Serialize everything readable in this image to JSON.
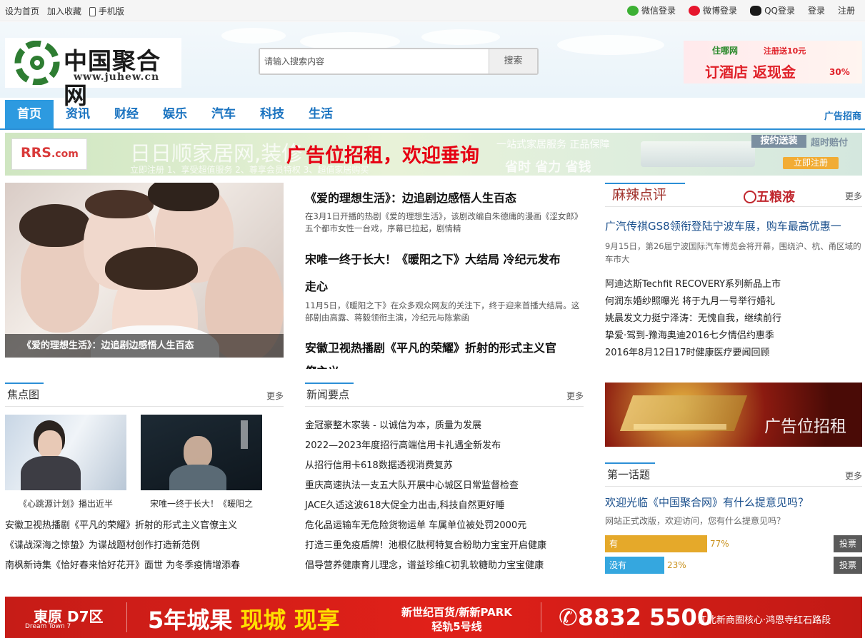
{
  "topbar": {
    "left": [
      "设为首页",
      "加入收藏",
      "手机版"
    ],
    "right": [
      "微信登录",
      "微博登录",
      "QQ登录",
      "登录",
      "注册"
    ]
  },
  "logo": {
    "name": "中国聚合网",
    "url": "www.juhew.cn"
  },
  "search": {
    "placeholder": "请输入搜索内容",
    "button": "搜索"
  },
  "header_ad": {
    "brand": "住哪网",
    "note": "注册送10元",
    "headline": "订酒店 返现金",
    "pct": "30%"
  },
  "nav": {
    "items": [
      "首页",
      "资讯",
      "财经",
      "娱乐",
      "汽车",
      "科技",
      "生活"
    ],
    "active": 0,
    "ad_link": "广告招商"
  },
  "banner": {
    "logo_top": "RRS",
    "logo_bottom": ".com",
    "bg_title": "日日顺家居网,装修",
    "bg_sub": "立即注册  1、享受超值服务   2、尊享会员特权   3、超值家居购买",
    "bg_right": "一站式家居服务 正品保障",
    "bg_right2": "省时 省力 省钱",
    "promo": "广告位招租，欢迎垂询",
    "tag1": "按约送装",
    "tag2": "超时赔付",
    "cta": "立即注册"
  },
  "feature": {
    "caption": "《爱的理想生活》：边追剧边感悟人生百态"
  },
  "articles": [
    {
      "title": "《爱的理想生活》：边追剧边感悟人生百态",
      "desc": "在3月1日开播的热剧《爱的理想生活》，该剧改编自朱德庸的漫画《涩女郎》 五个都市女性一台戏，序幕已拉起，剧情精"
    },
    {
      "title": "宋唯一终于长大！《暖阳之下》大结局 冷纪元发布",
      "title2": "走心",
      "desc": "11月5日，《暖阳之下》在众多观众网友的关注下，终于迎来首播大结局。这部剧由高露、蒋毅领衔主演，冷纪元与陈紫函"
    },
    {
      "title": "安徽卫视热播剧《平凡的荣耀》折射的形式主义官",
      "title2": "僚主义"
    }
  ],
  "malapingping": {
    "title": "麻辣点评",
    "brand": "五粮液",
    "more": "更多",
    "headline": "广汽传祺GS8领衔登陆宁波车展，购车最高优惠一",
    "desc": "9月15日，第26届宁波国际汽车博览会将开幕，围绕沪、杭、甬区域的车市大",
    "items": [
      "阿迪达斯Techfit RECOVERY系列新品上市",
      "何润东婚纱照曝光 将于九月一号举行婚礼",
      "姚晨发文力挺宁泽涛：无愧自我，继续前行",
      "挚爱·驾到-豫海奥迪2016七夕情侣约惠季",
      "2016年8月12日17时健康医疗要闻回顾"
    ]
  },
  "focus": {
    "title": "焦点图",
    "more": "更多",
    "thumbs": [
      "《心跳源计划》播出近半",
      "宋唯一终于长大！《暖阳之"
    ],
    "items": [
      "安徽卫视热播剧《平凡的荣耀》折射的形式主义官僚主义",
      "《谍战深海之惊蛰》为谍战题材创作打造新范例",
      "南枫新诗集《恰好春来恰好花开》面世 为冬季疫情增添春"
    ]
  },
  "news": {
    "title": "新闻要点",
    "more": "更多",
    "items": [
      "金冠豪整木家装 - 以诚信为本，质量为发展",
      "2022—2023年度招行高端信用卡礼遇全新发布",
      "从招行信用卡618数据透视消费复苏",
      "重庆高速执法一支五大队开展中心城区日常监督检查",
      "JACE久适这波618大促全力出击,科技自然更好睡",
      "危化品运输车无危险货物运单 车属单位被处罚2000元",
      "打造三重免疫盾牌！池根亿肽柯特复合粉助力宝宝开启健康",
      "倡导营养健康育儿理念，谱益珍维C初乳软糖助力宝宝健康"
    ]
  },
  "right_ad": {
    "text": "广告位招租"
  },
  "poll": {
    "title": "第一话题",
    "more": "更多",
    "question": "欢迎光临《中国聚合网》有什么提意见吗？",
    "desc": "网站正式改版，欢迎访问，您有什么提意见吗？",
    "options": [
      {
        "label": "有",
        "percent": 77,
        "percent_text": "77%",
        "color": "#e5a92a",
        "vote": "投票"
      },
      {
        "label": "没有",
        "percent": 23,
        "percent_text": "23%",
        "color": "#35a7df",
        "vote": "投票"
      }
    ]
  },
  "bottom_ad": {
    "brand": "東原 D7区",
    "brand_en": "Dream Town 7",
    "headline": "5年城果 ",
    "headline_hl": "现城 现享",
    "mid1": "新世纪百货/新新PARK",
    "mid2": "轻轨5号线",
    "phone": "✆8832 5500",
    "address": "江北新商圈核心·鸿恩寺红石路段"
  }
}
